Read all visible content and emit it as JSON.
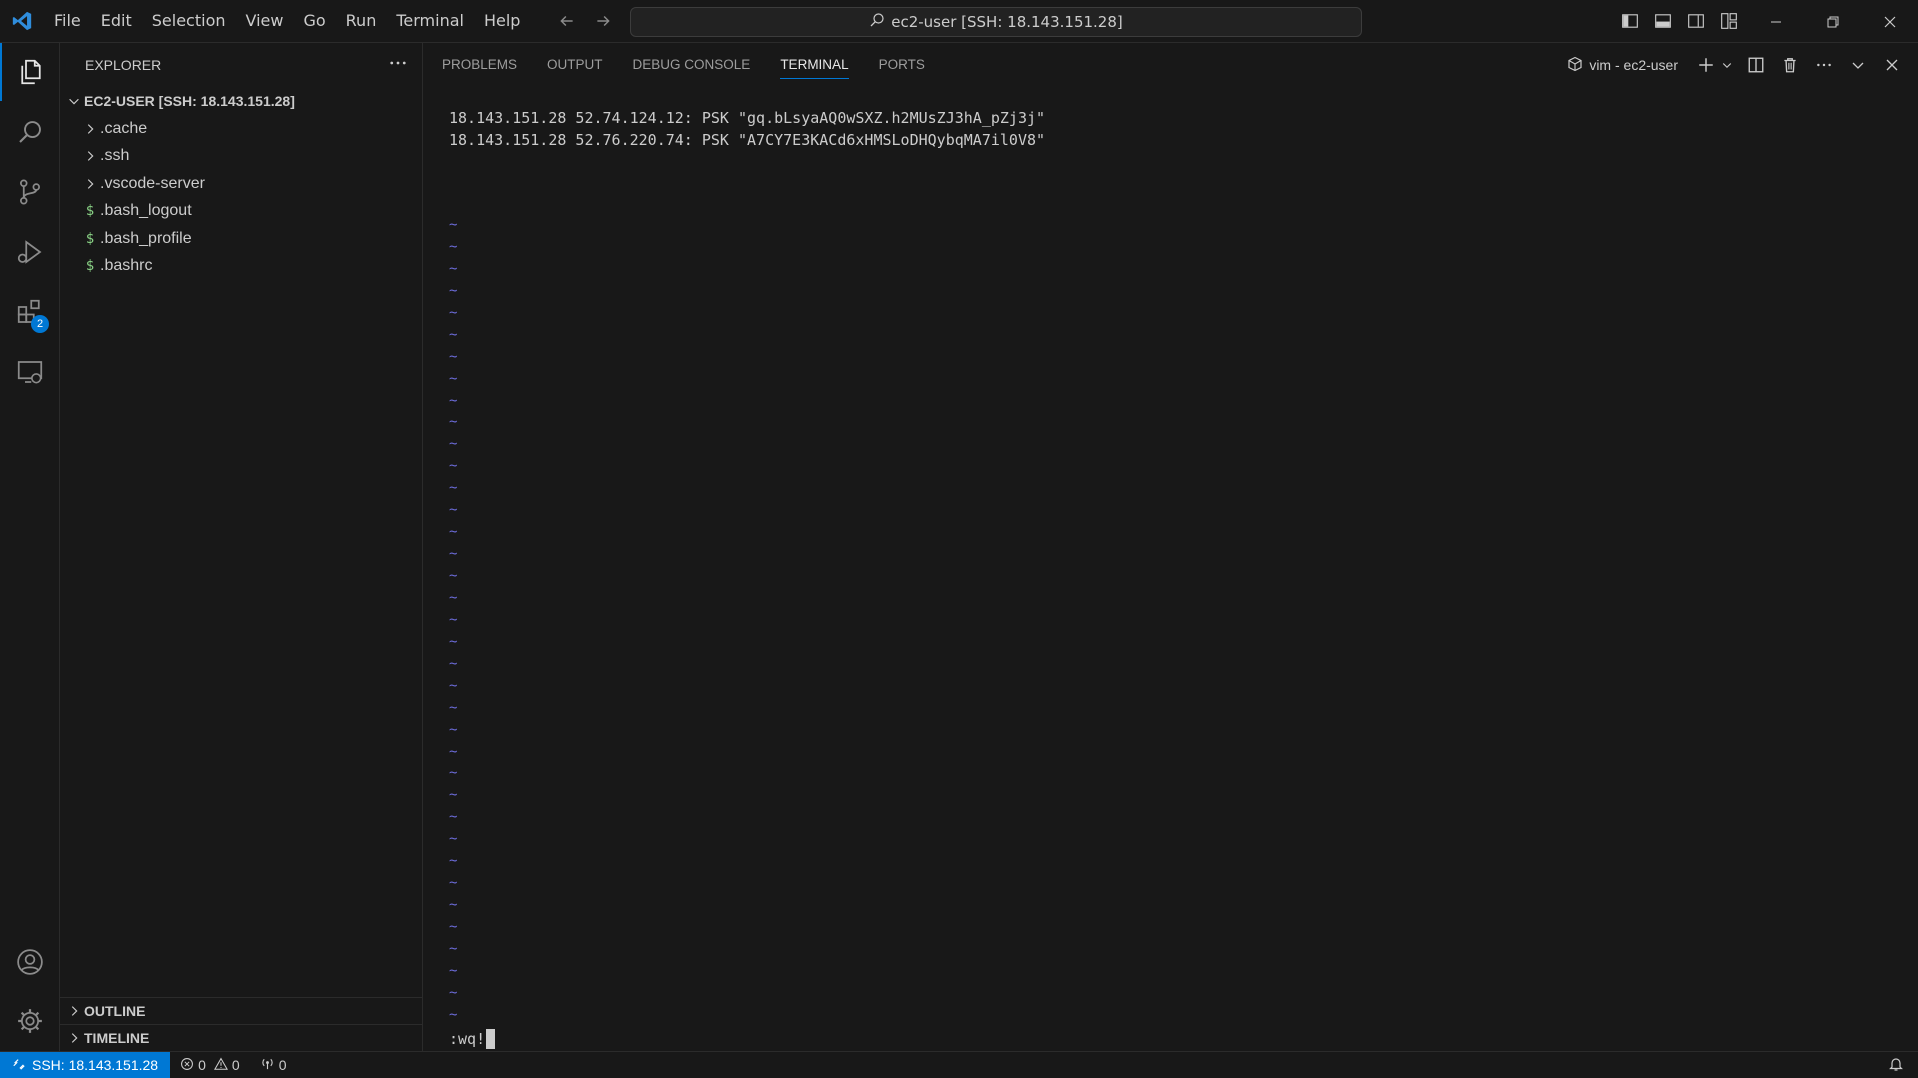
{
  "titlebar": {
    "menu": [
      "File",
      "Edit",
      "Selection",
      "View",
      "Go",
      "Run",
      "Terminal",
      "Help"
    ],
    "command_center": "ec2-user [SSH: 18.143.151.28]"
  },
  "activitybar": {
    "extensions_badge": "2"
  },
  "sidebar": {
    "title": "EXPLORER",
    "root_label": "EC2-USER [SSH: 18.143.151.28]",
    "items": [
      {
        "label": ".cache",
        "kind": "folder"
      },
      {
        "label": ".ssh",
        "kind": "folder"
      },
      {
        "label": ".vscode-server",
        "kind": "folder"
      },
      {
        "label": ".bash_logout",
        "kind": "file"
      },
      {
        "label": ".bash_profile",
        "kind": "file"
      },
      {
        "label": ".bashrc",
        "kind": "file"
      }
    ],
    "file_icon_glyph": "$",
    "outline_label": "OUTLINE",
    "timeline_label": "TIMELINE"
  },
  "panel": {
    "tabs": [
      "PROBLEMS",
      "OUTPUT",
      "DEBUG CONSOLE",
      "TERMINAL",
      "PORTS"
    ],
    "active_tab": "TERMINAL",
    "terminal_name": "vim - ec2-user"
  },
  "terminal": {
    "lines": [
      "18.143.151.28 52.74.124.12: PSK \"gq.bLsyaAQ0wSXZ.h2MUsZJ3hA_pZj3j\"",
      "18.143.151.28 52.76.220.74: PSK \"A7CY7E3KACd6xHMSLoDHQybqMA7il0V8\""
    ],
    "empty_line_marker": "~",
    "empty_line_count": 37,
    "command_line": ":wq!"
  },
  "statusbar": {
    "remote": "SSH: 18.143.151.28",
    "errors": "0",
    "warnings": "0",
    "ports": "0"
  },
  "colors": {
    "accent": "#0078d4",
    "background": "#181818",
    "vim_tilde": "#6b6bd8",
    "shell_file_icon": "#89d185"
  }
}
